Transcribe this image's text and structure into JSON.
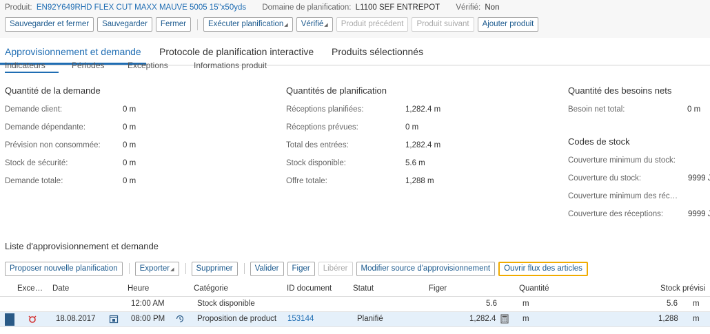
{
  "header": {
    "product_label": "Produit:",
    "product_value": "EN92Y649RHD FLEX CUT MAXX MAUVE 5005 15\"x50yds",
    "domain_label": "Domaine de planification:",
    "domain_value": "L1100 SEF ENTREPOT",
    "verified_label": "Vérifié:",
    "verified_value": "Non"
  },
  "toolbar": {
    "save_close": "Sauvegarder et fermer",
    "save": "Sauvegarder",
    "close": "Fermer",
    "run_planning": "Exécuter planification",
    "verified": "Vérifié",
    "prev_product": "Produit précédent",
    "next_product": "Produit suivant",
    "add_product": "Ajouter produit"
  },
  "tabs": [
    "Approvisionnement et demande",
    "Protocole de planification interactive",
    "Produits sélectionnés"
  ],
  "subtabs": [
    "Indicateurs",
    "Périodes",
    "Exceptions",
    "Informations produit"
  ],
  "demand": {
    "title": "Quantité de la demande",
    "rows": [
      {
        "label": "Demande client:",
        "value": "0 m"
      },
      {
        "label": "Demande dépendante:",
        "value": "0 m"
      },
      {
        "label": "Prévision non consommée:",
        "value": "0 m"
      },
      {
        "label": "Stock de sécurité:",
        "value": "0 m"
      },
      {
        "label": "Demande totale:",
        "value": "0 m"
      }
    ]
  },
  "planning": {
    "title": "Quantités de planification",
    "rows": [
      {
        "label": "Réceptions planifiées:",
        "value": "1,282.4 m"
      },
      {
        "label": "Réceptions prévues:",
        "value": "0 m"
      },
      {
        "label": "Total des entrées:",
        "value": "1,282.4 m"
      },
      {
        "label": "Stock disponible:",
        "value": "5.6 m"
      },
      {
        "label": "Offre totale:",
        "value": "1,288 m"
      }
    ]
  },
  "net": {
    "title": "Quantité des besoins nets",
    "label": "Besoin net total:",
    "value": "0 m"
  },
  "stock_codes": {
    "title": "Codes de stock",
    "rows": [
      {
        "label": "Couverture minimum du stock:",
        "value": ""
      },
      {
        "label": "Couverture du stock:",
        "value": "9999 J"
      },
      {
        "label": "Couverture minimum des réc…",
        "value": ""
      },
      {
        "label": "Couverture des réceptions:",
        "value": "9999 J"
      }
    ]
  },
  "list": {
    "title": "Liste d'approvisionnement et demande",
    "toolbar": {
      "propose": "Proposer nouvelle planification",
      "export": "Exporter",
      "delete": "Supprimer",
      "validate": "Valider",
      "fix": "Figer",
      "release": "Libérer",
      "modify_source": "Modifier source d'approvisionnement",
      "open_flow": "Ouvrir flux des articles"
    },
    "columns": [
      "Exce…",
      "Date",
      "Heure",
      "Catégorie",
      "ID document",
      "Statut",
      "Figer",
      "Quantité",
      "Stock prévisi"
    ],
    "rows": [
      {
        "date": "",
        "time": "12:00 AM",
        "category": "Stock disponible",
        "doc_id": "",
        "status": "",
        "qty": "5.6",
        "qty_unit": "m",
        "stock": "5.6",
        "stock_unit": "m"
      },
      {
        "date": "18.08.2017",
        "time": "08:00 PM",
        "category": "Proposition de product",
        "doc_id": "153144",
        "status": "Planifié",
        "qty": "1,282.4",
        "qty_unit": "m",
        "stock": "1,288",
        "stock_unit": "m"
      }
    ]
  },
  "colors": {
    "accent": "#1f6db3",
    "focus": "#f0ab00",
    "exception": "#d32f2f"
  }
}
